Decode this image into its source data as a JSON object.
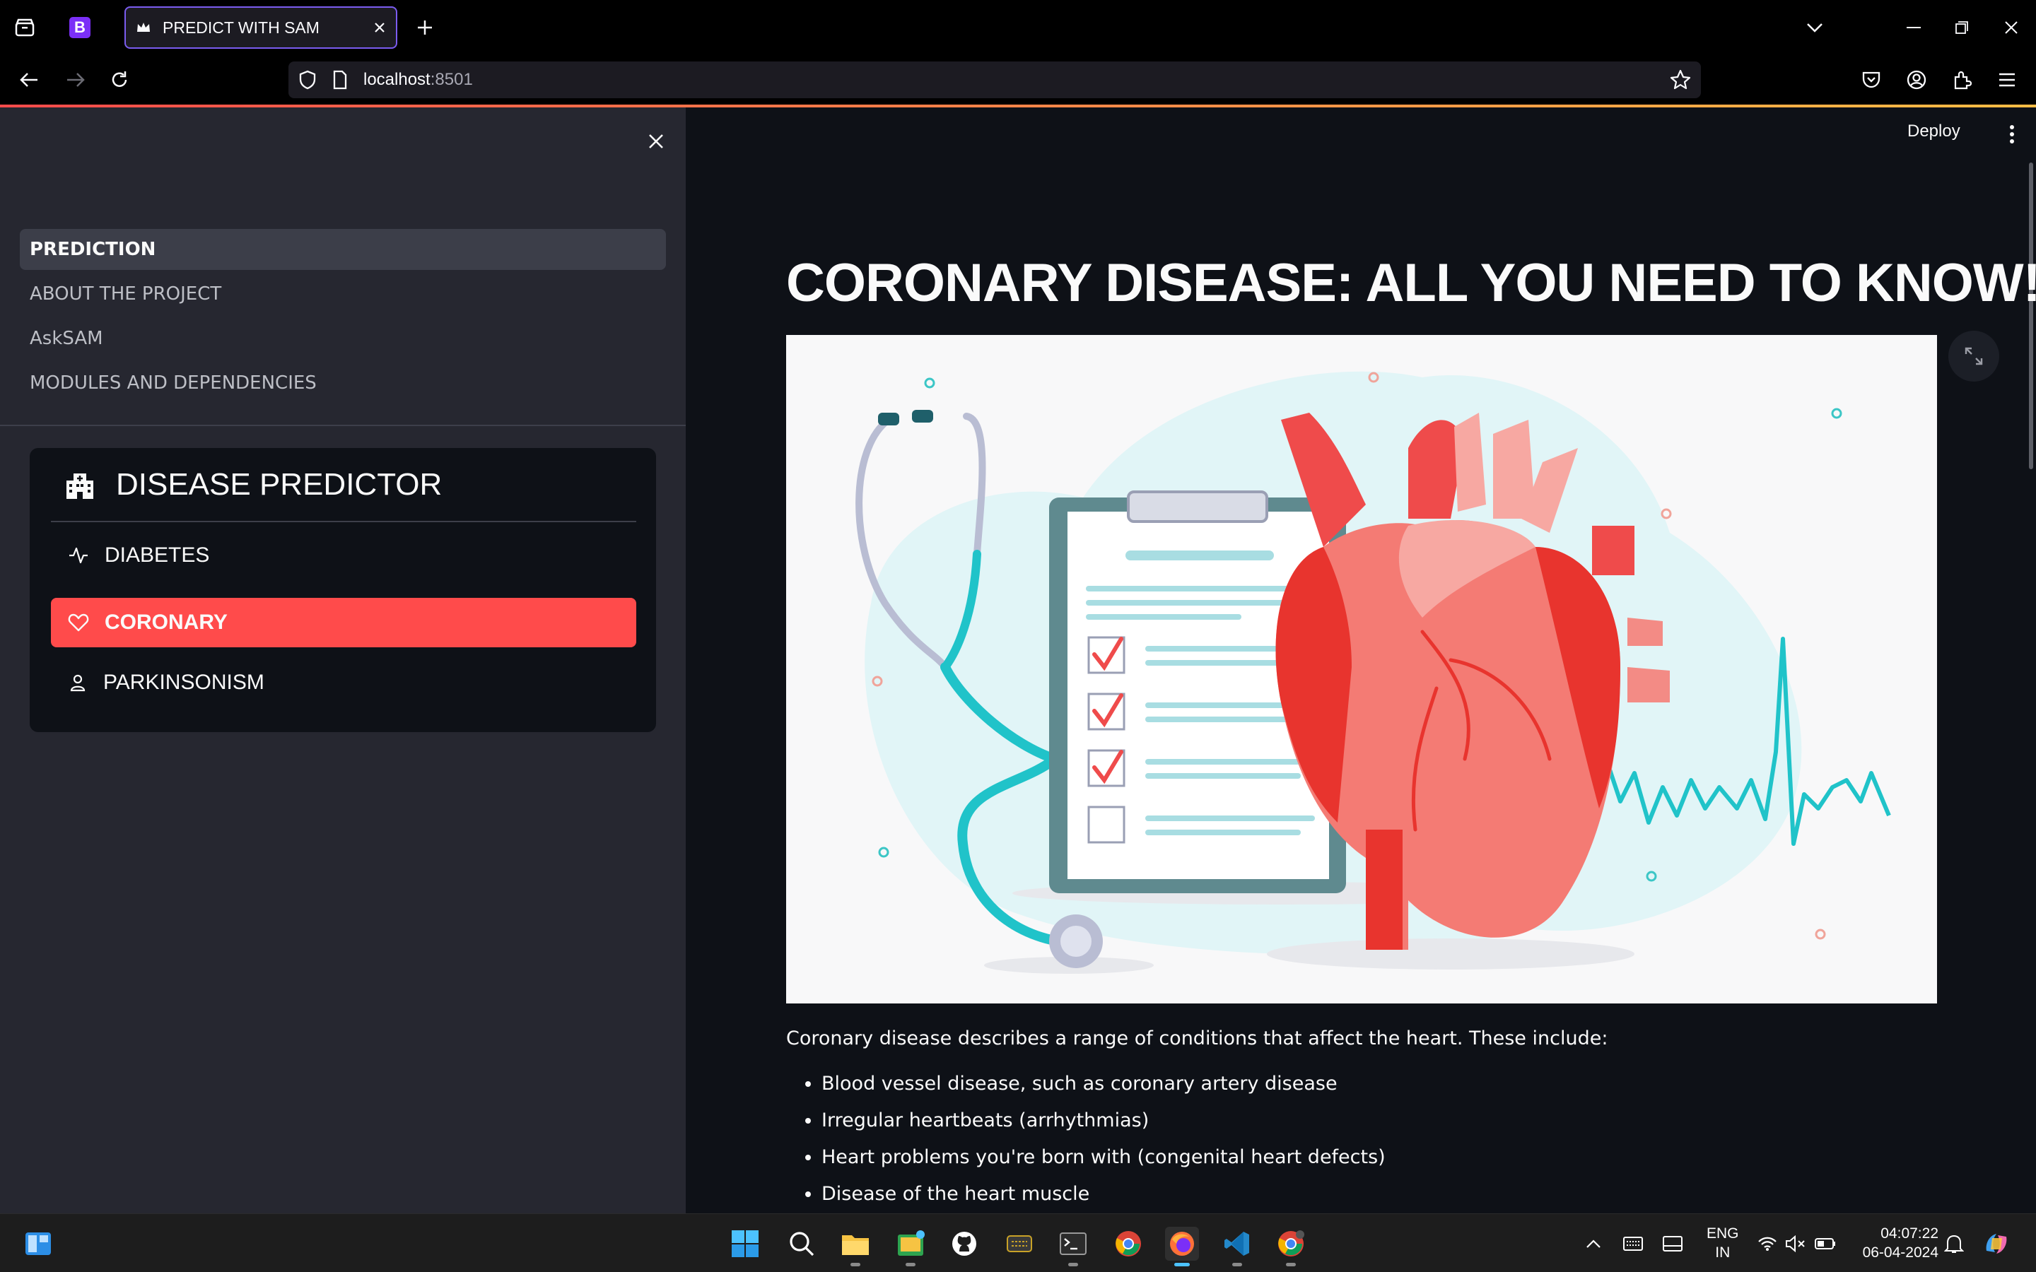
{
  "browser": {
    "tab_title": "PREDICT WITH SAM",
    "url_host": "localhost",
    "url_port": ":8501"
  },
  "sidebar": {
    "nav": [
      {
        "label": "PREDICTION",
        "active": true
      },
      {
        "label": "ABOUT THE PROJECT",
        "active": false
      },
      {
        "label": "AskSAM",
        "active": false
      },
      {
        "label": "MODULES AND DEPENDENCIES",
        "active": false
      }
    ],
    "predictor": {
      "title": "DISEASE PREDICTOR",
      "items": [
        {
          "label": "DIABETES",
          "icon": "activity-icon",
          "selected": false
        },
        {
          "label": "CORONARY",
          "icon": "heart-icon",
          "selected": true
        },
        {
          "label": "PARKINSONISM",
          "icon": "person-icon",
          "selected": false
        }
      ]
    }
  },
  "main": {
    "deploy_label": "Deploy",
    "title": "CORONARY DISEASE: ALL YOU NEED TO KNOW!",
    "intro": "Coronary disease describes a range of conditions that affect the heart. These include:",
    "bullets": [
      "Blood vessel disease, such as coronary artery disease",
      "Irregular heartbeats (arrhythmias)",
      "Heart problems you're born with (congenital heart defects)",
      "Disease of the heart muscle"
    ]
  },
  "taskbar": {
    "lang_line1": "ENG",
    "lang_line2": "IN",
    "time": "04:07:22",
    "date": "06-04-2024"
  },
  "colors": {
    "accent": "#ff4b4b",
    "sidebar_bg": "#262730",
    "main_bg": "#0e1117",
    "tab_border": "#7b5cf0"
  }
}
